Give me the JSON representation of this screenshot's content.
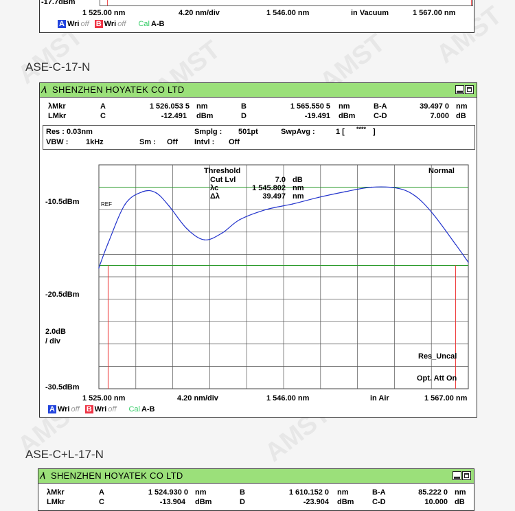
{
  "panel1": {
    "ref_level": "-17.7dBm",
    "x_start": "1 525.00 nm",
    "x_scale": "4.20 nm/div",
    "x_center": "1 546.00 nm",
    "medium": "in Vacuum",
    "x_stop": "1 567.00 nm",
    "legend": {
      "a": "A",
      "wri_a": "Wri",
      "off_a": "off",
      "b": "B",
      "wri_b": "Wri",
      "off_b": "off",
      "cal": "Cal",
      "ab": "A-B"
    }
  },
  "label2": "ASE-C-17-N",
  "panel2": {
    "title": "SHENZHEN HOYATEK CO LTD",
    "mkr": {
      "lmkr_label": "λMkr",
      "a_label": "A",
      "a_val": "1 526.053 5",
      "a_unit": "nm",
      "b_label": "B",
      "b_val": "1 565.550 5",
      "b_unit": "nm",
      "ba_label": "B-A",
      "ba_val": "39.497 0",
      "ba_unit": "nm",
      "lvmkr_label": "LMkr",
      "c_label": "C",
      "c_val": "-12.491",
      "c_unit": "dBm",
      "d_label": "D",
      "d_val": "-19.491",
      "d_unit": "dBm",
      "cd_label": "C-D",
      "cd_val": "7.000",
      "cd_unit": "dB"
    },
    "settings": {
      "res": "Res : 0.03nm",
      "smplg_label": "Smplg :",
      "smplg_val": "501pt",
      "swpavg_label": "SwpAvg :",
      "swpavg_val": "1 [",
      "swpavg_stars": "****",
      "swpavg_close": "]",
      "vbw": "VBW :",
      "vbw_val": "1kHz",
      "sm": "Sm :",
      "sm_val": "Off",
      "intvl": "Intvl :",
      "intvl_val": "Off"
    },
    "threshold": {
      "title": "Threshold",
      "cut_label": "Cut Lvl",
      "cut_val": "7.0",
      "cut_unit": "dB",
      "lc_label": "λc",
      "lc_val": "1 545.802",
      "lc_unit": "nm",
      "dl_label": "Δλ",
      "dl_val": "39.497",
      "dl_unit": "nm"
    },
    "mode": "Normal",
    "ref_tag": "REF",
    "y_top": "-10.5dBm",
    "y_mid": "-20.5dBm",
    "y_bot": "-30.5dBm",
    "y_scale_1": "2.0dB",
    "y_scale_2": "/ div",
    "res_uncal": "Res_Uncal",
    "opt_att": "Opt. Att On",
    "x_start": "1 525.00 nm",
    "x_scale": "4.20 nm/div",
    "x_center": "1 546.00 nm",
    "medium": "in Air",
    "x_stop": "1 567.00 nm",
    "legend": {
      "a": "A",
      "wri_a": "Wri",
      "off_a": "off",
      "b": "B",
      "wri_b": "Wri",
      "off_b": "off",
      "cal": "Cal",
      "ab": "A-B"
    }
  },
  "label3": "ASE-C+L-17-N",
  "panel3": {
    "title": "SHENZHEN HOYATEK CO LTD",
    "mkr": {
      "lmkr_label": "λMkr",
      "a_label": "A",
      "a_val": "1 524.930 0",
      "a_unit": "nm",
      "b_label": "B",
      "b_val": "1 610.152 0",
      "b_unit": "nm",
      "ba_label": "B-A",
      "ba_val": "85.222 0",
      "ba_unit": "nm",
      "lvmkr_label": "LMkr",
      "c_label": "C",
      "c_val": "-13.904",
      "c_unit": "dBm",
      "d_label": "D",
      "d_val": "-23.904",
      "d_unit": "dBm",
      "cd_label": "C-D",
      "cd_val": "10.000",
      "cd_unit": "dB"
    }
  },
  "chart_data": {
    "type": "line",
    "xlabel": "",
    "ylabel": "",
    "xlim": [
      1525.0,
      1567.0
    ],
    "ylim": [
      -30.5,
      -10.5
    ],
    "series": [
      {
        "x": [
          1525.0,
          1526.05,
          1528.0,
          1530.0,
          1531.5,
          1533.0,
          1535.0,
          1537.0,
          1539.0,
          1541.0,
          1544.0,
          1547.0,
          1550.0,
          1553.0,
          1556.0,
          1559.0,
          1561.0,
          1563.0,
          1565.55,
          1567.0
        ],
        "y": [
          -19.7,
          -17.5,
          -14.0,
          -12.9,
          -13.0,
          -14.2,
          -16.2,
          -17.2,
          -16.6,
          -15.4,
          -14.5,
          -14.0,
          -13.4,
          -12.9,
          -12.5,
          -12.6,
          -13.3,
          -14.9,
          -17.6,
          -19.2
        ]
      }
    ],
    "markers": {
      "a_nm": 1526.05,
      "b_nm": 1565.55,
      "c_dbm": -12.491,
      "d_dbm": -19.491
    },
    "grid": true
  }
}
